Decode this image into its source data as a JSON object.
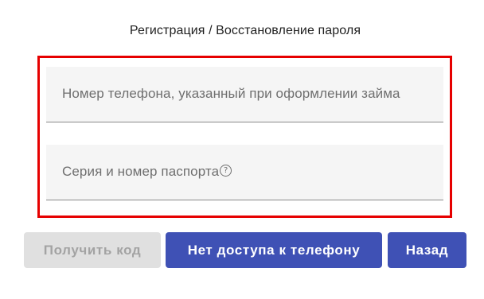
{
  "header": {
    "title": "Регистрация / Восстановление пароля"
  },
  "form": {
    "phone_placeholder": "Номер телефона, указанный при оформлении займа",
    "passport_placeholder": "Серия и номер паспорта",
    "help_icon_glyph": "?"
  },
  "actions": {
    "get_code_label": "Получить код",
    "no_phone_access_label": "Нет доступа к телефону",
    "back_label": "Назад"
  },
  "colors": {
    "highlight_border": "#e60000",
    "primary_button": "#3f51b5",
    "disabled_button": "#e0e0e0",
    "field_background": "#f5f5f5"
  }
}
